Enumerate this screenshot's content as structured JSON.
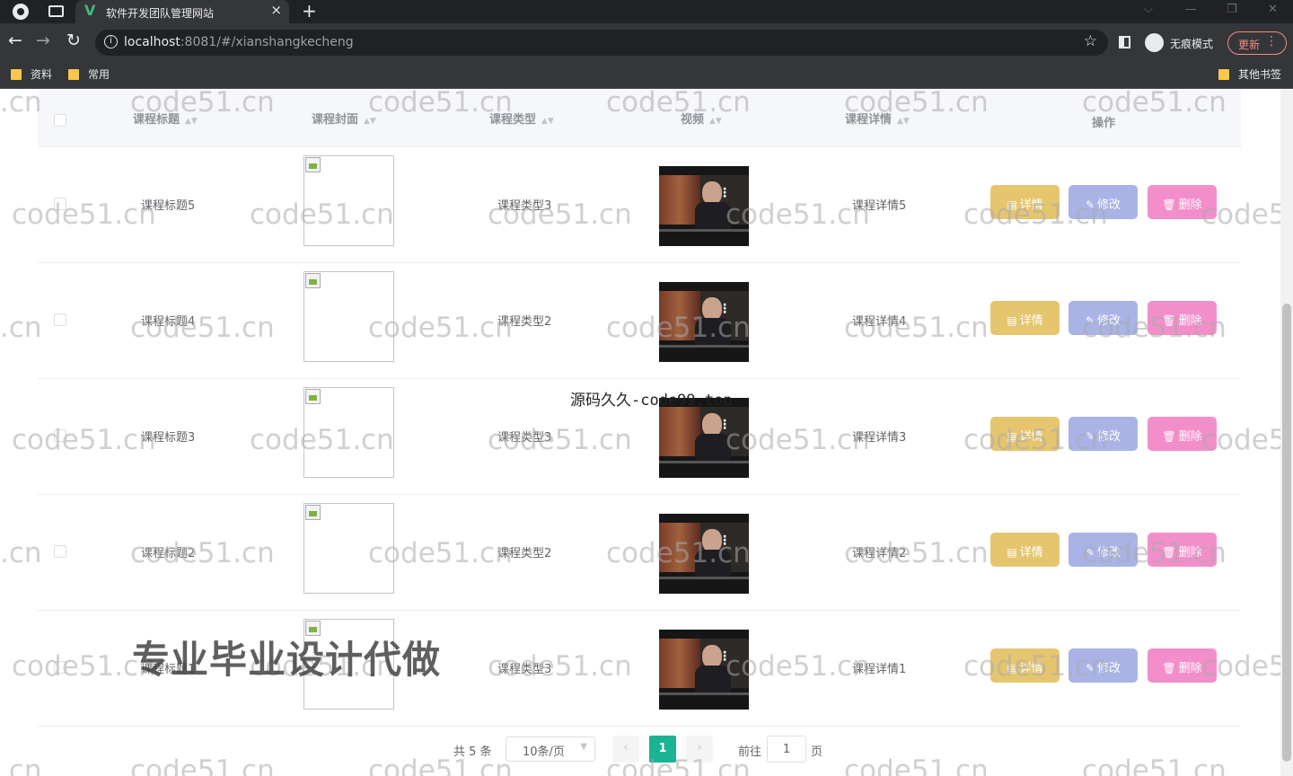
{
  "browser": {
    "tab_title": "软件开发团队管理网站",
    "tab_close": "×",
    "new_tab": "+",
    "url_host": "localhost",
    "url_rest": ":8081/#/xianshangkecheng",
    "incognito_label": "无痕模式",
    "update_label": "更新",
    "bookmarks": [
      "资料",
      "常用"
    ],
    "other_bookmarks": "其他书签"
  },
  "table": {
    "columns": [
      "课程标题",
      "课程封面",
      "课程类型",
      "视频",
      "课程详情",
      "操作"
    ],
    "rows": [
      {
        "title": "课程标题5",
        "type": "课程类型3",
        "detail": "课程详情5"
      },
      {
        "title": "课程标题4",
        "type": "课程类型2",
        "detail": "课程详情4"
      },
      {
        "title": "课程标题3",
        "type": "课程类型3",
        "detail": "课程详情3"
      },
      {
        "title": "课程标题2",
        "type": "课程类型2",
        "detail": "课程详情2"
      },
      {
        "title": "课程标题1",
        "type": "课程类型3",
        "detail": "课程详情1"
      }
    ],
    "actions": {
      "detail": "详情",
      "edit": "修改",
      "delete": "删除"
    }
  },
  "pagination": {
    "total": "共 5 条",
    "page_size": "10条/页",
    "current_page": "1",
    "goto_label": "前往",
    "goto_value": "1",
    "page_unit": "页"
  },
  "watermarks": {
    "site": "code51.cn",
    "site_partial": ".cn",
    "center": "源码久久-code99.top",
    "big": "专业毕业设计代做"
  },
  "colors": {
    "accent": "#1ab394",
    "detail_button": "#e6c56f",
    "edit_button": "#a9b3e6",
    "delete_button": "#f28fcb"
  }
}
